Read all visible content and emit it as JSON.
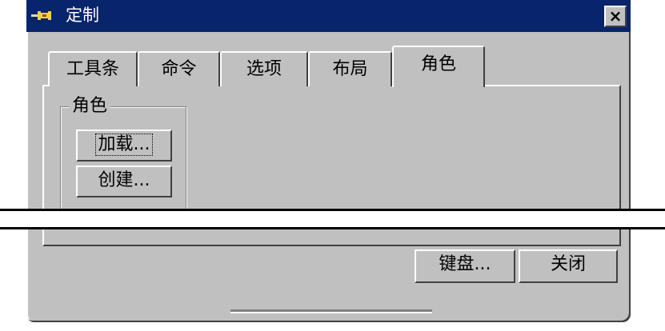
{
  "window": {
    "title": "定制",
    "close_label": "×"
  },
  "tabs": [
    {
      "label": "工具条",
      "active": false
    },
    {
      "label": "命令",
      "active": false
    },
    {
      "label": "选项",
      "active": false
    },
    {
      "label": "布局",
      "active": false
    },
    {
      "label": "角色",
      "active": true
    }
  ],
  "roles_group": {
    "label": "角色",
    "load_button": "加载...",
    "create_button": "创建..."
  },
  "footer": {
    "keyboard_button": "键盘...",
    "close_button": "关闭"
  },
  "colors": {
    "titlebar": "#08246b",
    "face": "#c0c0c0"
  }
}
